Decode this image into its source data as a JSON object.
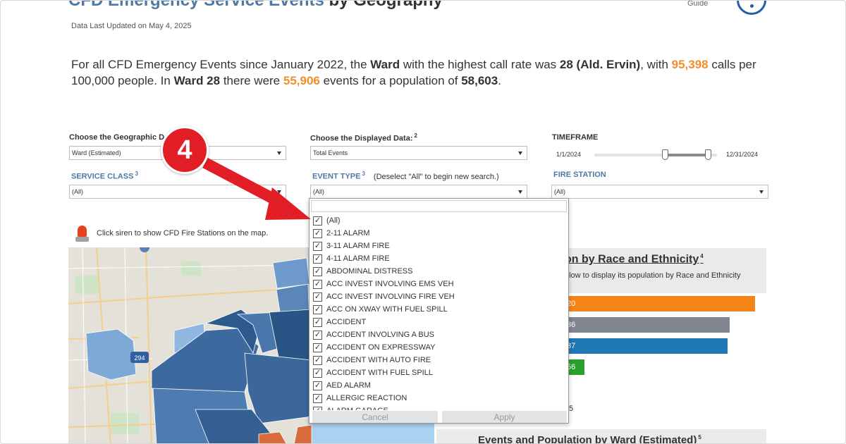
{
  "header": {
    "title_blue": "CFD Emergency Service Events",
    "title_dark": " by Geography",
    "guide_label": "Guide",
    "updated": "Data Last Updated on May 4, 2025"
  },
  "summary": {
    "part1": "For all CFD Emergency Events since January 2022, the ",
    "ward_word": "Ward",
    "part2": " with the highest call rate was ",
    "ward_name": "28 (Ald. Ervin)",
    "part3": ", with ",
    "rate": "95,398",
    "part4": " calls per 100,000 people. In ",
    "ward_short": "Ward 28",
    "part5": "  there were ",
    "events": "55,906",
    "part6": " events for a population of ",
    "population": "58,603",
    "part7": "."
  },
  "filters": {
    "geo_label": "Choose the Geographic D",
    "geo_value": "Ward (Estimated)",
    "data_label": "Choose the Displayed Data:",
    "data_sup": "2",
    "data_value": "Total Events",
    "timeframe_label": "TIMEFRAME",
    "timeframe_start": "1/1/2024",
    "timeframe_end": "12/31/2024",
    "service_label": "SERVICE CLASS",
    "service_sup": "3",
    "service_value": "(All)",
    "event_label": "EVENT TYPE",
    "event_sup": "3",
    "event_note": "(Deselect \"All\" to begin new search.)",
    "event_value": "(All)",
    "station_label": "FIRE STATION",
    "station_value": "(All)"
  },
  "siren": {
    "text": "Click siren to show CFD Fire Stations on the map."
  },
  "map": {
    "highway_label": "294"
  },
  "chart": {
    "title": "on by Race and Ethnicity",
    "title_sup": "4",
    "subtitle": "elow to display its population by Race and Ethnicity",
    "bars": [
      {
        "label": "20",
        "value": 275,
        "color": "#f58518"
      },
      {
        "label": "36",
        "value": 239,
        "color": "#7f8591"
      },
      {
        "label": "37",
        "value": 236,
        "color": "#1f77b4"
      },
      {
        "label": "56",
        "value": 33,
        "color": "#2ca02c"
      }
    ],
    "trailing_label": "5"
  },
  "bottom": {
    "title": "Events and Population by Ward (Estimated)",
    "title_sup": "5"
  },
  "dropdown": {
    "items": [
      "(All)",
      "2-11 ALARM",
      "3-11 ALARM FIRE",
      "4-11 ALARM FIRE",
      "ABDOMINAL DISTRESS",
      "ACC INVEST INVOLVING EMS VEH",
      "ACC INVEST INVOLVING FIRE VEH",
      "ACC ON XWAY WITH FUEL SPILL",
      "ACCIDENT",
      "ACCIDENT INVOLVING A BUS",
      "ACCIDENT ON EXPRESSWAY",
      "ACCIDENT WITH AUTO FIRE",
      "ACCIDENT WITH FUEL SPILL",
      "AED ALARM",
      "ALLERGIC REACTION",
      "ALARM GARAGE"
    ],
    "check_mark": "✓",
    "cancel": "Cancel",
    "apply": "Apply"
  },
  "annotation": {
    "step_number": "4",
    "badge_color": "#e11e26"
  }
}
